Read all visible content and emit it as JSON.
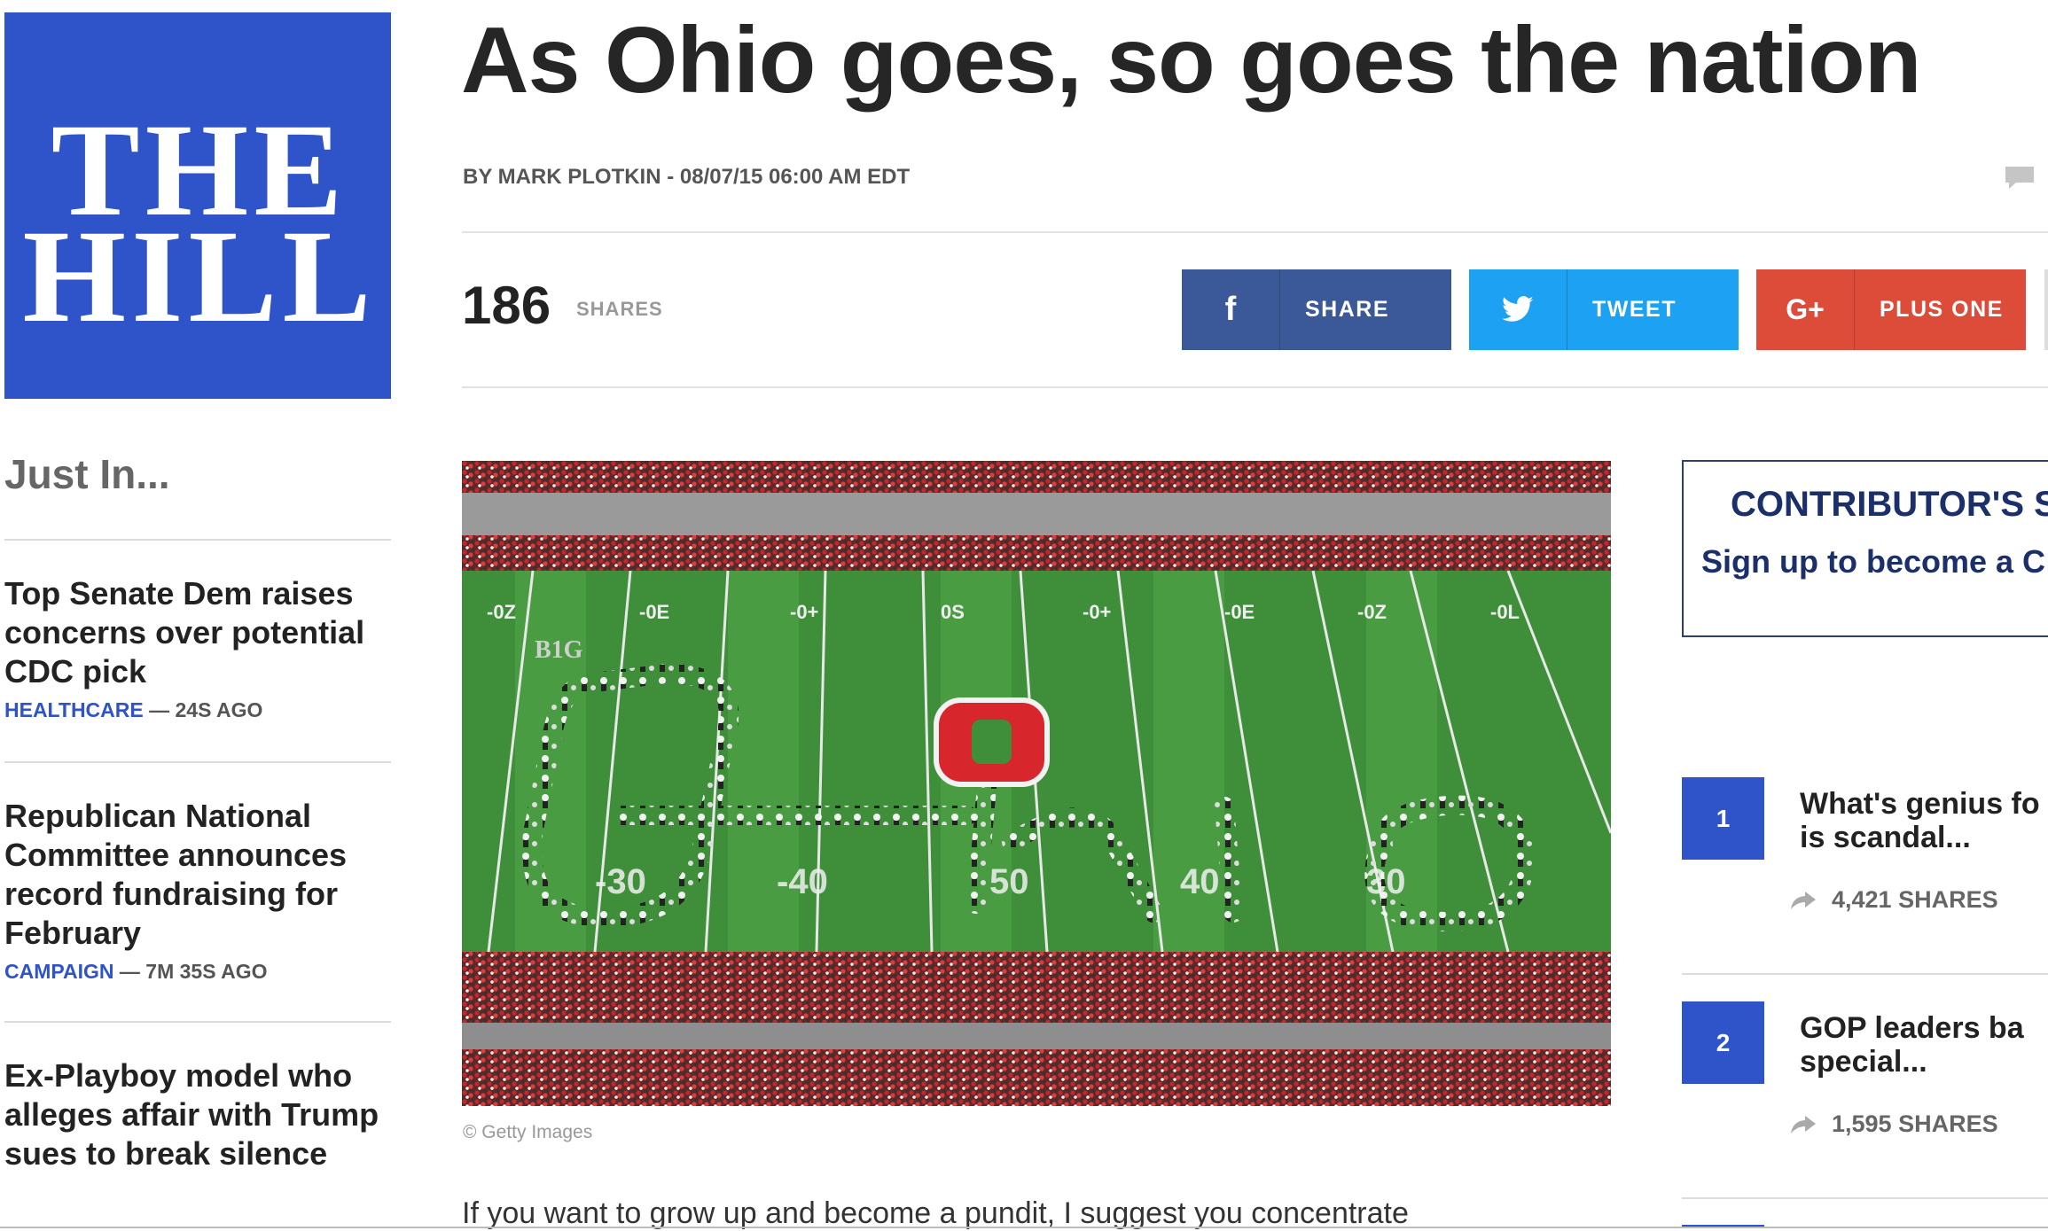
{
  "brand": {
    "logo_line1": "THE",
    "logo_line2": "HILL",
    "color": "#2f53c8"
  },
  "article": {
    "headline": "As Ohio goes, so goes the nation",
    "byline": "BY MARK PLOTKIN - 08/07/15 06:00 AM EDT",
    "image_credit": "© Getty Images",
    "body_start": "If you want to grow up and become a pundit, I suggest you concentrate"
  },
  "share_bar": {
    "count": "186",
    "label": "SHARES",
    "buttons": [
      {
        "icon": "facebook-icon",
        "glyph": "f",
        "label": "SHARE",
        "color": "#3b5998"
      },
      {
        "icon": "twitter-icon",
        "glyph": "",
        "label": "TWEET",
        "color": "#1da1f2"
      },
      {
        "icon": "google-plus-icon",
        "glyph": "G+",
        "label": "PLUS ONE",
        "color": "#dd4b39"
      }
    ]
  },
  "just_in": {
    "heading": "Just In...",
    "stories": [
      {
        "title": "Top Senate Dem raises concerns over potential CDC pick",
        "category": "HEALTHCARE",
        "time": " — 24S AGO"
      },
      {
        "title": "Republican National Committee announces record fundraising for February",
        "category": "CAMPAIGN",
        "time": " — 7M 35S AGO"
      },
      {
        "title": "Ex-Playboy model who alleges affair with Trump sues to break silence",
        "category": "",
        "time": ""
      }
    ]
  },
  "sidebar": {
    "contributor_heading": "CONTRIBUTOR'S S",
    "contributor_sub": "Sign up to become a C",
    "popular": [
      {
        "rank": "1",
        "title_line1": "What's genius fo",
        "title_line2": "is scandal...",
        "shares": "4,421 SHARES"
      },
      {
        "rank": "2",
        "title_line1": "GOP leaders ba",
        "title_line2": "special...",
        "shares": "1,595 SHARES"
      }
    ]
  },
  "photo_field": {
    "yard_top": [
      "-0Z",
      "-0E",
      "-0+",
      "0S",
      "-0+",
      "-0E",
      "-0Z",
      "-0L"
    ],
    "yard_bottom": [
      "-30",
      "-40",
      "50",
      "40",
      "30"
    ],
    "conference": "B1G"
  }
}
